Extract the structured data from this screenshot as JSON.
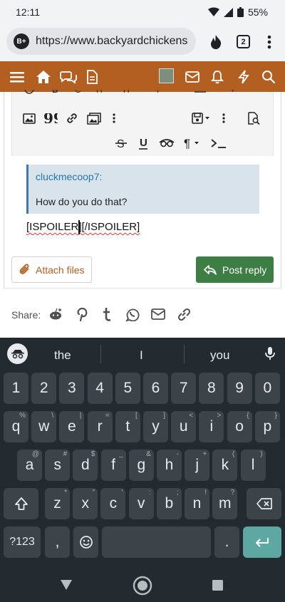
{
  "status": {
    "time": "12:11",
    "battery": "55%"
  },
  "browser": {
    "url": "https://www.backyardchickens",
    "tab_count": "2",
    "site_badge": "B+"
  },
  "editor": {
    "quote_author": "cluckmecoop7:",
    "quote_text": "How do you do that?",
    "body_tag_open": "[ISPOILER]",
    "body_tag_close": "[/ISPOILER]"
  },
  "actions": {
    "attach_label": "Attach files",
    "post_label": "Post reply"
  },
  "share": {
    "label": "Share:"
  },
  "keyboard": {
    "suggestions": [
      "the",
      "I",
      "you"
    ],
    "row_numbers": [
      "1",
      "2",
      "3",
      "4",
      "5",
      "6",
      "7",
      "8",
      "9",
      "0"
    ],
    "row1": [
      {
        "k": "q",
        "h": "%"
      },
      {
        "k": "w",
        "h": "\\"
      },
      {
        "k": "e",
        "h": "|"
      },
      {
        "k": "r",
        "h": "="
      },
      {
        "k": "t",
        "h": "["
      },
      {
        "k": "y",
        "h": "]"
      },
      {
        "k": "u",
        "h": "<"
      },
      {
        "k": "i",
        "h": ">"
      },
      {
        "k": "o",
        "h": "{"
      },
      {
        "k": "p",
        "h": "}"
      }
    ],
    "row2": [
      {
        "k": "a",
        "h": "@"
      },
      {
        "k": "s",
        "h": "#"
      },
      {
        "k": "d",
        "h": "$"
      },
      {
        "k": "f",
        "h": "_"
      },
      {
        "k": "g",
        "h": "&"
      },
      {
        "k": "h",
        "h": "-"
      },
      {
        "k": "j",
        "h": "+"
      },
      {
        "k": "k",
        "h": "("
      },
      {
        "k": "l",
        "h": ")"
      }
    ],
    "row3": [
      {
        "k": "z",
        "h": "*"
      },
      {
        "k": "x",
        "h": "\""
      },
      {
        "k": "c",
        "h": "'"
      },
      {
        "k": "v",
        "h": ":"
      },
      {
        "k": "b",
        "h": ";"
      },
      {
        "k": "n",
        "h": "!"
      },
      {
        "k": "m",
        "h": "?"
      }
    ],
    "symbols_label": "?123",
    "comma": ",",
    "period": "."
  },
  "colors": {
    "site_nav": "#b35f21",
    "post_button": "#3d7e45",
    "quote_border": "#3a79b4",
    "keyboard_bg": "#232b30",
    "enter_key": "#5ea8a3"
  }
}
